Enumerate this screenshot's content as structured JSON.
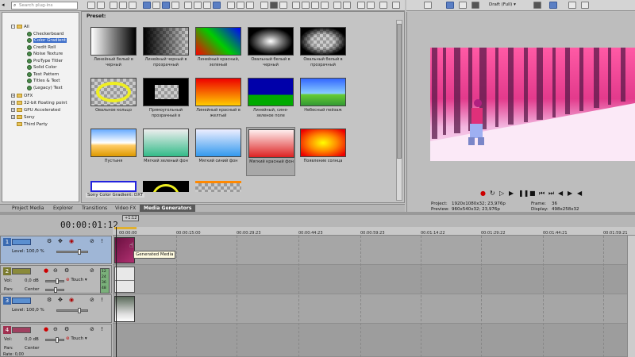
{
  "explorer": {
    "search_placeholder": "Search plug-ins",
    "tree": [
      {
        "label": "All",
        "level": 0,
        "kind": "folder",
        "expanded": true
      },
      {
        "label": "Checkerboard",
        "level": 1,
        "kind": "gear"
      },
      {
        "label": "Color Gradient",
        "level": 1,
        "kind": "gear",
        "selected": true
      },
      {
        "label": "Credit Roll",
        "level": 1,
        "kind": "gear"
      },
      {
        "label": "Noise Texture",
        "level": 1,
        "kind": "gear"
      },
      {
        "label": "ProType Titler",
        "level": 1,
        "kind": "gear"
      },
      {
        "label": "Solid Color",
        "level": 1,
        "kind": "gear"
      },
      {
        "label": "Test Pattern",
        "level": 1,
        "kind": "gear"
      },
      {
        "label": "Titles & Text",
        "level": 1,
        "kind": "gear"
      },
      {
        "label": "(Legacy) Text",
        "level": 1,
        "kind": "gear"
      },
      {
        "label": "OFX",
        "level": 0,
        "kind": "folder"
      },
      {
        "label": "32-bit floating point",
        "level": 0,
        "kind": "folder"
      },
      {
        "label": "GPU Accelerated",
        "level": 0,
        "kind": "folder"
      },
      {
        "label": "Sony",
        "level": 0,
        "kind": "folder"
      },
      {
        "label": "Third Party",
        "level": 0,
        "kind": "folder"
      }
    ]
  },
  "presets": {
    "header": "Preset:",
    "status": "Sony Color Gradient: DXT",
    "items": [
      "Линейный белый в черный",
      "Линейный черный в прозрачный",
      "Линейный красный, зеленый",
      "Овальный белый в черный",
      "Овальный белый в прозрачный",
      "Овальное кольцо",
      "Прямоугольный прозрачный в",
      "Линейный красный в желтый",
      "Линейный, сине-зеленое поле",
      "Небесный пейзаж",
      "Пустыня",
      "Мягкий зеленый фон",
      "Мягкий синий фон",
      "Мягкий красный фон",
      "Появление солнца"
    ]
  },
  "tabs": [
    "Project Media",
    "Explorer",
    "Transitions",
    "Video FX",
    "Media Generators"
  ],
  "preview": {
    "quality": "Draft (Full)",
    "project_label": "Project:",
    "project_value": "1920x1080x32; 23,976p",
    "preview_label": "Preview:",
    "preview_value": "960x540x32; 23,976p",
    "frame_label": "Frame:",
    "frame_value": "36",
    "display_label": "Display:",
    "display_value": "498x258x32"
  },
  "timeline": {
    "timecode": "00:00:01:12",
    "cursor_flag": "+1:12",
    "ruler": [
      "00:00:00",
      "00:00:15:00",
      "00:00:29:23",
      "00:00:44:23",
      "00:00:59:23",
      "00:01:14:22",
      "00:01:29:22",
      "00:01:44:21",
      "00:01:59:21"
    ],
    "tooltip": "Generated Media",
    "tracks": [
      {
        "number": "1",
        "type": "video",
        "level_label": "Level:",
        "level": "100,0 %"
      },
      {
        "number": "2",
        "type": "audio",
        "vol_label": "Vol:",
        "vol": "0,0 dB",
        "pan_label": "Pan:",
        "pan": "Center",
        "mode": "Touch"
      },
      {
        "number": "3",
        "type": "video",
        "level_label": "Level:",
        "level": "100,0 %"
      },
      {
        "number": "4",
        "type": "audio",
        "vol_label": "Vol:",
        "vol": "0,0 dB",
        "pan_label": "Pan:",
        "pan": "Center",
        "mode": "Touch"
      }
    ],
    "meter_labels": [
      "12",
      "24",
      "36",
      "48"
    ],
    "rate_label": "Rate: 0,00"
  },
  "colors": {
    "accent": "#3d6ec9",
    "track_video": "#5a8fd0",
    "track_audio": "#8a8a3a"
  }
}
